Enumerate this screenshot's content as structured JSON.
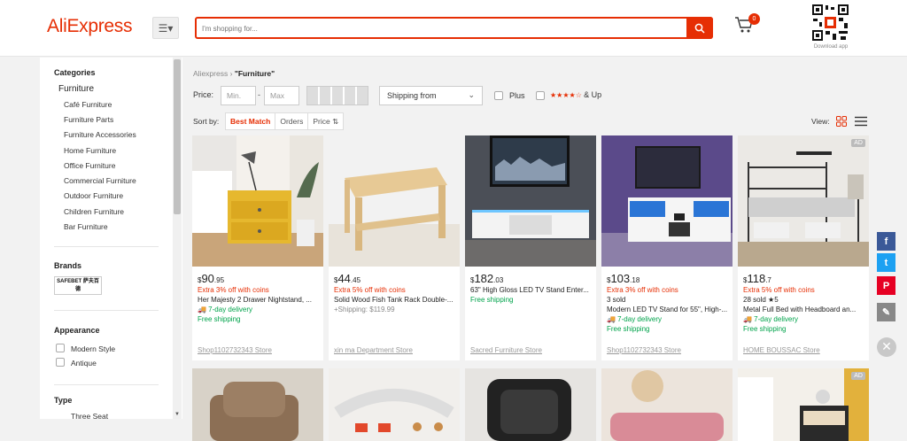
{
  "header": {
    "logo": "AliExpress",
    "search_placeholder": "I'm shopping for...",
    "cart_count": "0",
    "download_app": "Download app"
  },
  "sidebar": {
    "categories_title": "Categories",
    "main_category": "Furniture",
    "items": [
      "Café Furniture",
      "Furniture Parts",
      "Furniture Accessories",
      "Home Furniture",
      "Office Furniture",
      "Commercial Furniture",
      "Outdoor Furniture",
      "Children Furniture",
      "Bar Furniture"
    ],
    "brands_title": "Brands",
    "brand_logo_text": "SAFEBET 萨夫百德",
    "appearance_title": "Appearance",
    "appearance_options": [
      "Modern Style",
      "Antique"
    ],
    "type_title": "Type",
    "type_options": [
      "Three Seat"
    ]
  },
  "breadcrumb": {
    "root": "Aliexpress",
    "sep": "›",
    "current": "\"Furniture\""
  },
  "filters": {
    "price_label": "Price:",
    "min_placeholder": "Min.",
    "max_placeholder": "Max",
    "dash": "-",
    "shipping": "Shipping from",
    "plus": "Plus",
    "stars": "★★★★☆",
    "and_up": "& Up"
  },
  "sort": {
    "label": "Sort by:",
    "options": [
      "Best Match",
      "Orders",
      "Price"
    ],
    "view_label": "View:"
  },
  "products": [
    {
      "price_main": "$90",
      "price_cents": ".95",
      "extra": "Extra 3% off with coins",
      "lines": [
        {
          "text": "Her Majesty 2 Drawer Nightstand, ...",
          "cls": ""
        },
        {
          "text": "🚚 7-day delivery",
          "cls": "green"
        },
        {
          "text": "Free shipping",
          "cls": "green"
        }
      ],
      "store": "Shop1102732343 Store",
      "ad": ""
    },
    {
      "price_main": "$44",
      "price_cents": ".45",
      "extra": "Extra 5% off with coins",
      "lines": [
        {
          "text": "Solid Wood Fish Tank Rack Double-...",
          "cls": ""
        },
        {
          "text": "+Shipping: $119.99",
          "cls": "gray"
        }
      ],
      "store": "xin ma Department Store",
      "ad": ""
    },
    {
      "price_main": "$182",
      "price_cents": ".03",
      "extra": "",
      "lines": [
        {
          "text": "63\" High Gloss LED TV Stand Enter...",
          "cls": ""
        },
        {
          "text": "Free shipping",
          "cls": "green"
        }
      ],
      "store": "Sacred Furniture Store",
      "ad": ""
    },
    {
      "price_main": "$103",
      "price_cents": ".18",
      "extra": "Extra 3% off with coins",
      "lines": [
        {
          "text": "3 sold",
          "cls": ""
        },
        {
          "text": "Modern LED TV Stand for 55\", High-...",
          "cls": ""
        },
        {
          "text": "🚚 7-day delivery",
          "cls": "green"
        },
        {
          "text": "Free shipping",
          "cls": "green"
        }
      ],
      "store": "Shop1102732343 Store",
      "ad": ""
    },
    {
      "price_main": "$118",
      "price_cents": ".7",
      "extra": "Extra 5% off with coins",
      "lines": [
        {
          "text": "28 sold  ★5",
          "cls": ""
        },
        {
          "text": "Metal Full Bed with Headboard an...",
          "cls": ""
        },
        {
          "text": "🚚 7-day delivery",
          "cls": "green"
        },
        {
          "text": "Free shipping",
          "cls": "green"
        }
      ],
      "store": "HOME BOUSSAC Store",
      "ad": "AD"
    }
  ],
  "row2_ad": "AD",
  "social": [
    "f",
    "t",
    "P",
    "✎"
  ],
  "colors": {
    "accent": "#e62e04",
    "green": "#00a34b"
  }
}
